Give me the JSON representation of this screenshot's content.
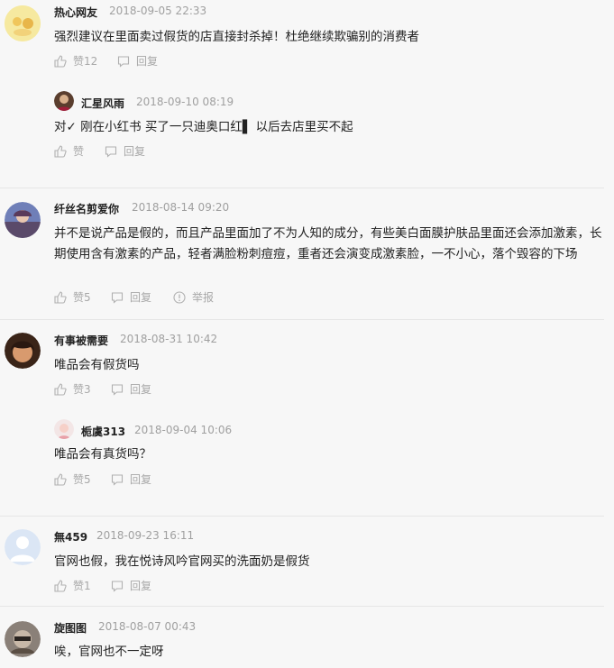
{
  "comments": [
    {
      "user": "热心网友",
      "time": "2018-09-05 22:33",
      "text": "强烈建议在里面卖过假货的店直接封杀掉！杜绝继续欺骗别的消费者",
      "like": "赞12",
      "reply": "回复"
    },
    {
      "user": "汇星风雨",
      "time": "2018-09-10 08:19",
      "text": "对✓ 刚在小红书 买了一只迪奥口红▌ 以后去店里买不起",
      "like": "赞",
      "reply": "回复"
    },
    {
      "user": "纤丝名剪爱你",
      "time": "2018-08-14 09:20",
      "text": "并不是说产品是假的，而且产品里面加了不为人知的成分，有些美白面膜护肤品里面还会添加激素，长期使用含有激素的产品，轻者满脸粉刺痘痘，重者还会演变成激素脸，一不小心，落个毁容的下场",
      "like": "赞5",
      "reply": "回复",
      "report": "举报"
    },
    {
      "user": "有事被需要",
      "time": "2018-08-31 10:42",
      "text": "唯品会有假货吗",
      "like": "赞3",
      "reply": "回复"
    },
    {
      "user": "栀虞313",
      "time": "2018-09-04 10:06",
      "text": "唯品会有真货吗？",
      "like": "赞5",
      "reply": "回复"
    },
    {
      "user": "無459",
      "time": "2018-09-23 16:11",
      "text": "官网也假，我在悦诗风吟官网买的洗面奶是假货",
      "like": "赞1",
      "reply": "回复"
    },
    {
      "user": "旋图图",
      "time": "2018-08-07 00:43",
      "text": "唉，官网也不一定呀"
    }
  ],
  "icons": {
    "like": "thumbs-up-icon",
    "reply": "comment-bubble-icon",
    "report": "warning-circle-icon"
  },
  "colors": {
    "meta": "#a0a0a0",
    "text": "#222222",
    "divider": "#e6e6e6",
    "background": "#f7f7f7"
  }
}
